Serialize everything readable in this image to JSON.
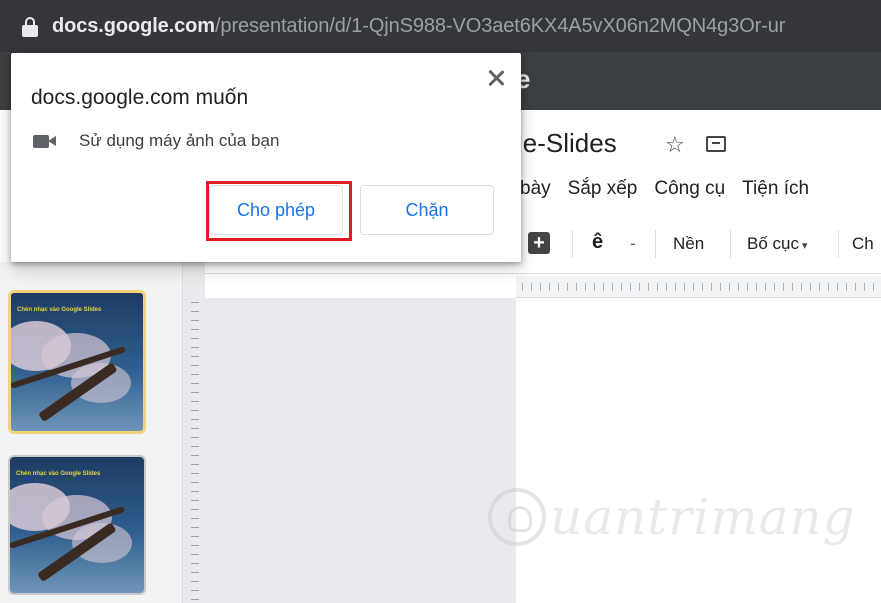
{
  "address_bar": {
    "host": "docs.google.com",
    "path": "/presentation/d/1-QjnS988-VO3aet6KX4A5vX06n2MQN4g3Or-ur",
    "lock_icon": "lock-icon"
  },
  "app": {
    "background_glyph": "e",
    "doc_title": "le-Slides",
    "menu": [
      "bày",
      "Sắp xếp",
      "Công cụ",
      "Tiện ích"
    ],
    "toolbar": {
      "insert_glyph": "+",
      "font_glyph": "ê",
      "dropdown_glyph": "-",
      "background": "Nền",
      "layout": "Bố cục",
      "more": "Ch"
    },
    "thumbnails": [
      {
        "caption": "Chèn nhạc vào Google Slides"
      },
      {
        "caption": "Chèn nhạc vào Google Slides"
      }
    ]
  },
  "popup": {
    "title": "docs.google.com muốn",
    "permission_icon": "camera-icon",
    "permission_text": "Sử dụng máy ảnh của bạn",
    "allow_label": "Cho phép",
    "block_label": "Chặn",
    "highlight_color": "#e01b24"
  },
  "watermark": {
    "text": "uantrimang"
  }
}
